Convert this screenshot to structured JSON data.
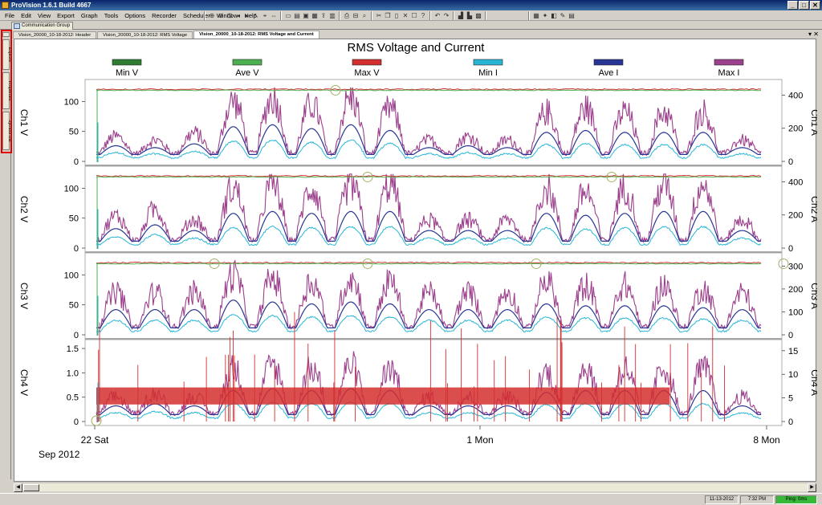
{
  "window": {
    "title": "ProVision 1.6.1 Build 4667",
    "controls": [
      "_",
      "□",
      "✕"
    ]
  },
  "menu": [
    "File",
    "Edit",
    "View",
    "Export",
    "Graph",
    "Tools",
    "Options",
    "Recorder",
    "Scheduler",
    "Window",
    "Help"
  ],
  "comm_tab": "Communication Group",
  "side_panel": [
    "Explore",
    "Properties",
    "Symbol Bar"
  ],
  "doc_tabs": [
    {
      "label": "Vision_20000_10-18-2012: Header",
      "active": false
    },
    {
      "label": "Vision_20000_10-18-2012: RMS Voltage",
      "active": false
    },
    {
      "label": "Vision_20000_10-18-2012: RMS Voltage and Current",
      "active": true
    }
  ],
  "doc_tab_close": "▾ ✕",
  "chart_data": {
    "type": "line",
    "title": "RMS Voltage and Current",
    "legend_position": "top",
    "series": [
      {
        "name": "Min V",
        "color": "#2e7d32"
      },
      {
        "name": "Ave V",
        "color": "#4caf50"
      },
      {
        "name": "Max V",
        "color": "#d32f2f"
      },
      {
        "name": "Min I",
        "color": "#29b6d6"
      },
      {
        "name": "Ave I",
        "color": "#283593"
      },
      {
        "name": "Max I",
        "color": "#9c3f8c"
      }
    ],
    "x_tick_labels": [
      "22 Sat",
      "1 Mon",
      "8 Mon"
    ],
    "x_sub_label": "Sep 2012",
    "panels": [
      {
        "ylabel_left": "Ch1 V",
        "ylabel_right": "Ch1 A",
        "left_ticks": [
          0,
          50,
          100
        ],
        "right_ticks": [
          0,
          200,
          400
        ],
        "ylim_left": [
          0,
          130
        ],
        "ylim_right": [
          0,
          470
        ],
        "voltage_level": 120,
        "current_peaks": [
          0.35,
          0.3,
          0.4,
          0.85,
          0.9,
          0.8,
          0.9,
          0.75,
          0.3,
          0.35,
          0.3,
          0.7,
          0.75,
          0.7,
          0.7,
          0.7,
          0.3
        ]
      },
      {
        "ylabel_left": "Ch2 V",
        "ylabel_right": "Ch2 A",
        "left_ticks": [
          0,
          50,
          100
        ],
        "right_ticks": [
          0,
          200,
          400
        ],
        "ylim_left": [
          0,
          130
        ],
        "ylim_right": [
          0,
          470
        ],
        "voltage_level": 120,
        "current_peaks": [
          0.45,
          0.55,
          0.4,
          0.85,
          0.9,
          0.85,
          0.9,
          0.9,
          0.4,
          0.4,
          0.4,
          0.85,
          0.8,
          0.85,
          0.9,
          0.9,
          0.4
        ]
      },
      {
        "ylabel_left": "Ch3 V",
        "ylabel_right": "Ch3 A",
        "left_ticks": [
          0,
          50,
          100
        ],
        "right_ticks": [
          0,
          100,
          200,
          300
        ],
        "ylim_left": [
          0,
          130
        ],
        "ylim_right": [
          0,
          340
        ],
        "voltage_level": 120,
        "current_peaks": [
          0.6,
          0.6,
          0.6,
          0.85,
          0.8,
          0.75,
          0.8,
          0.75,
          0.6,
          0.6,
          0.6,
          0.75,
          0.7,
          0.7,
          0.7,
          0.65,
          0.6
        ]
      },
      {
        "ylabel_left": "Ch4 V",
        "ylabel_right": "Ch4 A",
        "left_ticks": [
          0,
          0.5,
          1.0,
          1.5
        ],
        "right_ticks": [
          0,
          5,
          10,
          15
        ],
        "ylim_left": [
          0,
          1.6
        ],
        "ylim_right": [
          0,
          16.5
        ],
        "voltage_level": 0.7,
        "current_peaks": [
          0.35,
          0.4,
          0.35,
          0.75,
          0.8,
          0.75,
          0.8,
          0.75,
          0.35,
          0.35,
          0.35,
          0.7,
          0.75,
          0.75,
          0.75,
          0.75,
          0.35
        ]
      }
    ]
  },
  "status_bar": {
    "date": "11-13-2012",
    "time": "7:32 PM",
    "ping": "Ping: 0ms"
  }
}
